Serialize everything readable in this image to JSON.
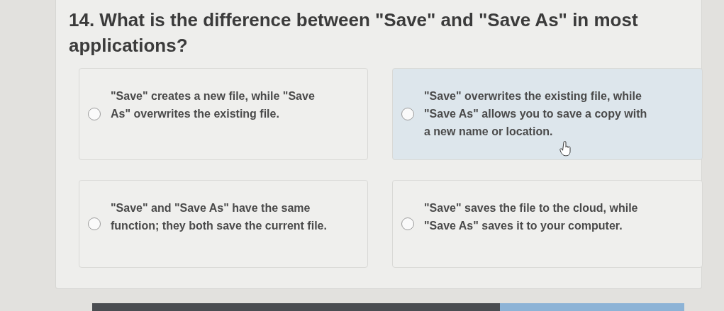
{
  "question": {
    "title": "14. What is the difference between \"Save\" and \"Save As\" in most applications?"
  },
  "options": [
    {
      "text": "\"Save\" creates a new file, while \"Save As\" overwrites the existing file.",
      "selected": false,
      "hovered": false
    },
    {
      "text": "\"Save\" overwrites the existing file, while \"Save As\" allows you to save a copy with a new name or location.",
      "selected": false,
      "hovered": true
    },
    {
      "text": "\"Save\" and \"Save As\" have the same function; they both save the current file.",
      "selected": false,
      "hovered": false
    },
    {
      "text": "\"Save\" saves the file to the cloud, while \"Save As\" saves it to your computer.",
      "selected": false,
      "hovered": false
    }
  ]
}
